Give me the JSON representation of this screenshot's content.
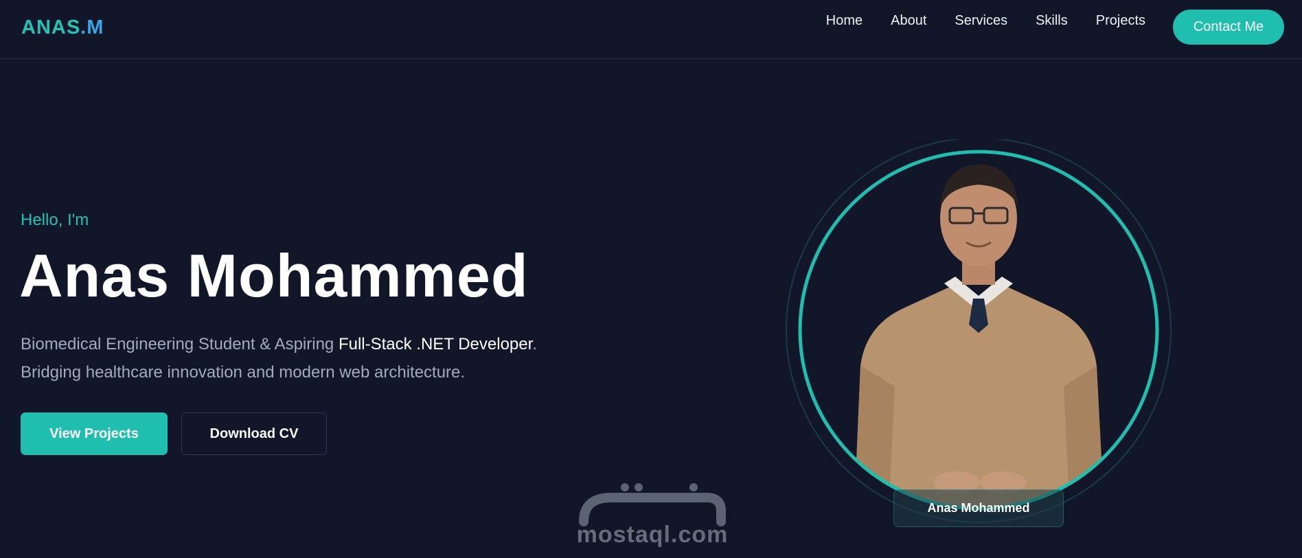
{
  "brand": {
    "logo_main": "ANAS",
    "logo_dot": ".M"
  },
  "nav": {
    "links": [
      "Home",
      "About",
      "Services",
      "Skills",
      "Projects"
    ],
    "contact_label": "Contact Me"
  },
  "hero": {
    "greeting": "Hello, I'm",
    "name": "Anas Mohammed",
    "tagline_part1": "Biomedical Engineering Student & Aspiring ",
    "tagline_highlight": "Full-Stack .NET Developer",
    "tagline_part2": ".",
    "tagline_line2": "Bridging healthcare innovation and modern web architecture.",
    "primary_button": "View Projects",
    "secondary_button": "Download CV"
  },
  "portrait": {
    "name_card": "Anas Mohammed"
  },
  "watermark": {
    "text": "mostaql.com"
  },
  "colors": {
    "background": "#111729",
    "accent": "#1fbeae",
    "accent_text": "#22c3b6",
    "muted_text": "#a1abbd"
  }
}
